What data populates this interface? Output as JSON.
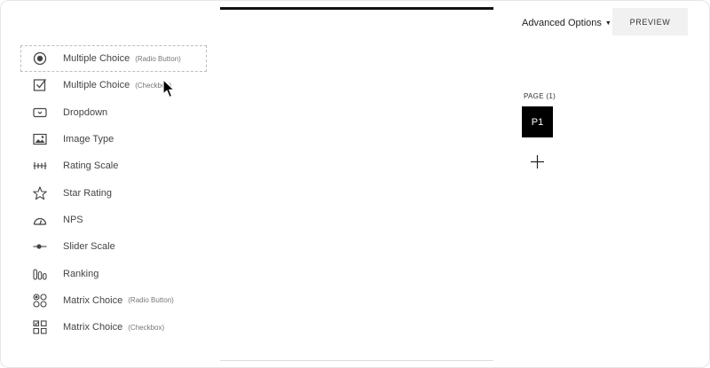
{
  "header": {
    "advanced_options_label": "Advanced Options",
    "advanced_options_caret": "▼",
    "preview_label": "PREVIEW"
  },
  "question_types": [
    {
      "label": "Multiple Choice",
      "sublabel": "(Radio Button)",
      "icon": "radio-button-icon",
      "selected": true
    },
    {
      "label": "Multiple Choice",
      "sublabel": "(Checkbox)",
      "icon": "checkbox-icon",
      "selected": false
    },
    {
      "label": "Dropdown",
      "sublabel": "",
      "icon": "dropdown-icon",
      "selected": false
    },
    {
      "label": "Image Type",
      "sublabel": "",
      "icon": "image-icon",
      "selected": false
    },
    {
      "label": "Rating Scale",
      "sublabel": "",
      "icon": "rating-scale-icon",
      "selected": false
    },
    {
      "label": "Star Rating",
      "sublabel": "",
      "icon": "star-icon",
      "selected": false
    },
    {
      "label": "NPS",
      "sublabel": "",
      "icon": "gauge-icon",
      "selected": false
    },
    {
      "label": "Slider Scale",
      "sublabel": "",
      "icon": "slider-icon",
      "selected": false
    },
    {
      "label": "Ranking",
      "sublabel": "",
      "icon": "ranking-icon",
      "selected": false
    },
    {
      "label": "Matrix Choice",
      "sublabel": "(Radio Button)",
      "icon": "matrix-radio-icon",
      "selected": false
    },
    {
      "label": "Matrix Choice",
      "sublabel": "(Checkbox)",
      "icon": "matrix-checkbox-icon",
      "selected": false
    }
  ],
  "pages": {
    "label": "PAGE (1)",
    "items": [
      "P1"
    ],
    "add_icon": "plus-icon"
  },
  "colors": {
    "page_tile_bg": "#000000",
    "preview_bg": "#f1f1f1",
    "text": "#444444"
  }
}
